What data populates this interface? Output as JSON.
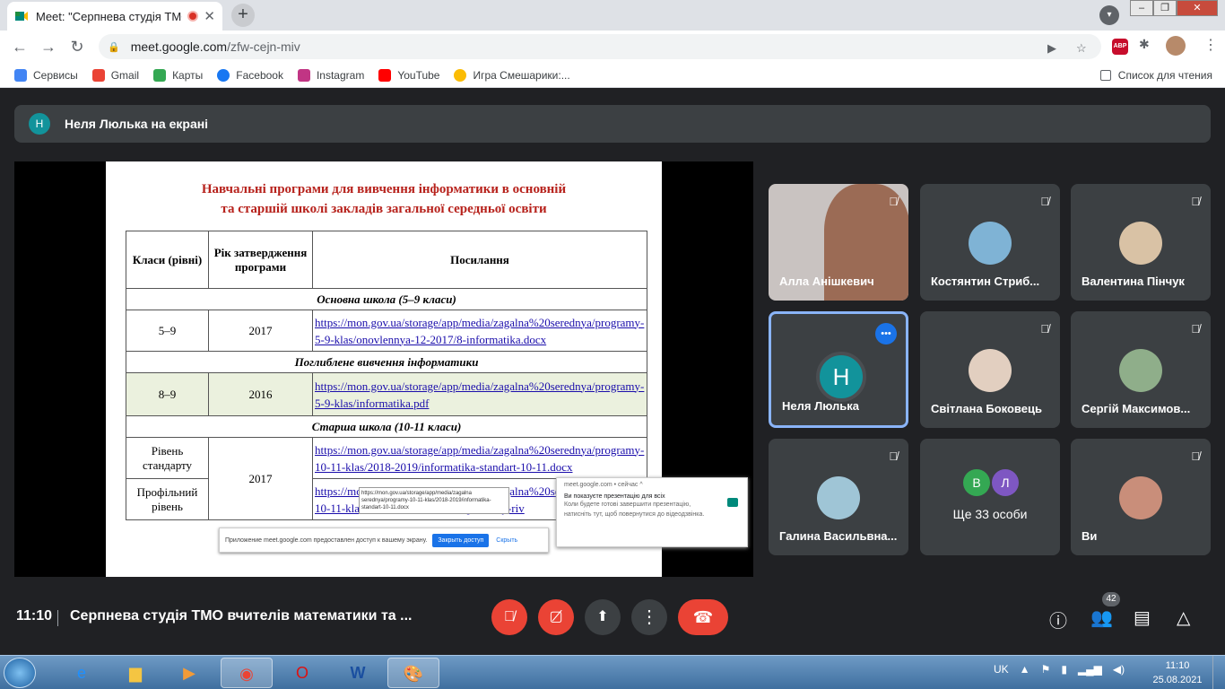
{
  "browser": {
    "tab_title": "Meet: \"Серпнева студія ТМО",
    "url_host": "meet.google.com",
    "url_path": "/zfw-cejn-miv",
    "abp_label": "ABP",
    "bookmarks": [
      {
        "label": "Сервисы",
        "color": "#4285f4"
      },
      {
        "label": "Gmail",
        "color": "#ea4335"
      },
      {
        "label": "Карты",
        "color": "#34a853"
      },
      {
        "label": "Facebook",
        "color": "#1877f2"
      },
      {
        "label": "Instagram",
        "color": "#c13584"
      },
      {
        "label": "YouTube",
        "color": "#ff0000"
      },
      {
        "label": "Игра Смешарики:...",
        "color": "#fbbc04"
      }
    ],
    "reading_list": "Список для чтения"
  },
  "meet": {
    "banner_initial": "Н",
    "banner_text": "Неля Люлька на екрані",
    "slide": {
      "title_line1": "Навчальні програми для вивчення інформатики в основній",
      "title_line2": "та старшій школі закладів загальної середньої освіти",
      "headers": [
        "Класи (рівні)",
        "Рік затвердження програми",
        "Посилання"
      ],
      "section1": "Основна школа (5–9 класи)",
      "row1": {
        "classes": "5–9",
        "year": "2017",
        "link": "https://mon.gov.ua/storage/app/media/zagalna%20serednya/programy-5-9-klas/onovlennya-12-2017/8-informatika.docx"
      },
      "section2": "Поглиблене вивчення інформатики",
      "row2": {
        "classes": "8–9",
        "year": "2016",
        "link": "https://mon.gov.ua/storage/app/media/zagalna%20serednya/programy-5-9-klas/informatika.pdf"
      },
      "section3": "Старша школа (10-11 класи)",
      "row3": {
        "classes": "Рівень стандарту",
        "year": "2017",
        "link": "https://mon.gov.ua/storage/app/media/zagalna%20serednya/programy-10-11-klas/2018-2019/informatika-standart-10-11.docx"
      },
      "row4": {
        "classes": "Профільний рівень",
        "link": "https://mon.gov.ua/storage/app/media/zagalna%20serednya/programy-10-11-klas/2018-2019/01/10-11-profilniy-riv"
      },
      "tooltip": "https://mon.gov.ua/storage/app/media/zagalna serednya/programy-10-11-klas/2018-2019/informatika-standart-10-11.docx",
      "share_text": "Приложение meet.google.com предоставлен доступ к вашему экрану.",
      "share_stop": "Закрыть доступ",
      "share_hide": "Скрыть",
      "notif_head": "meet.google.com • сейчас ^",
      "notif_title": "Ви показуєте презентацію для всіх",
      "notif_body": "Коли будете готові завершити презентацію, натисніть тут, щоб повернутися до відеодзвінка."
    },
    "participants": [
      {
        "name": "Алла Анішкевич"
      },
      {
        "name": "Костянтин Стриб..."
      },
      {
        "name": "Валентина Пінчук"
      },
      {
        "name": "Неля Люлька",
        "initial": "Н"
      },
      {
        "name": "Світлана Боковець"
      },
      {
        "name": "Сергій Максимов..."
      },
      {
        "name": "Галина Васильвна..."
      },
      {
        "name": "Ще 33 особи",
        "initials": [
          "В",
          "Л"
        ]
      },
      {
        "name": "Ви"
      }
    ],
    "time": "11:10",
    "meeting_title": "Серпнева студія ТМО вчителів математики та ...",
    "people_count": "42"
  },
  "taskbar": {
    "lang": "UK",
    "time": "11:10",
    "date": "25.08.2021"
  }
}
